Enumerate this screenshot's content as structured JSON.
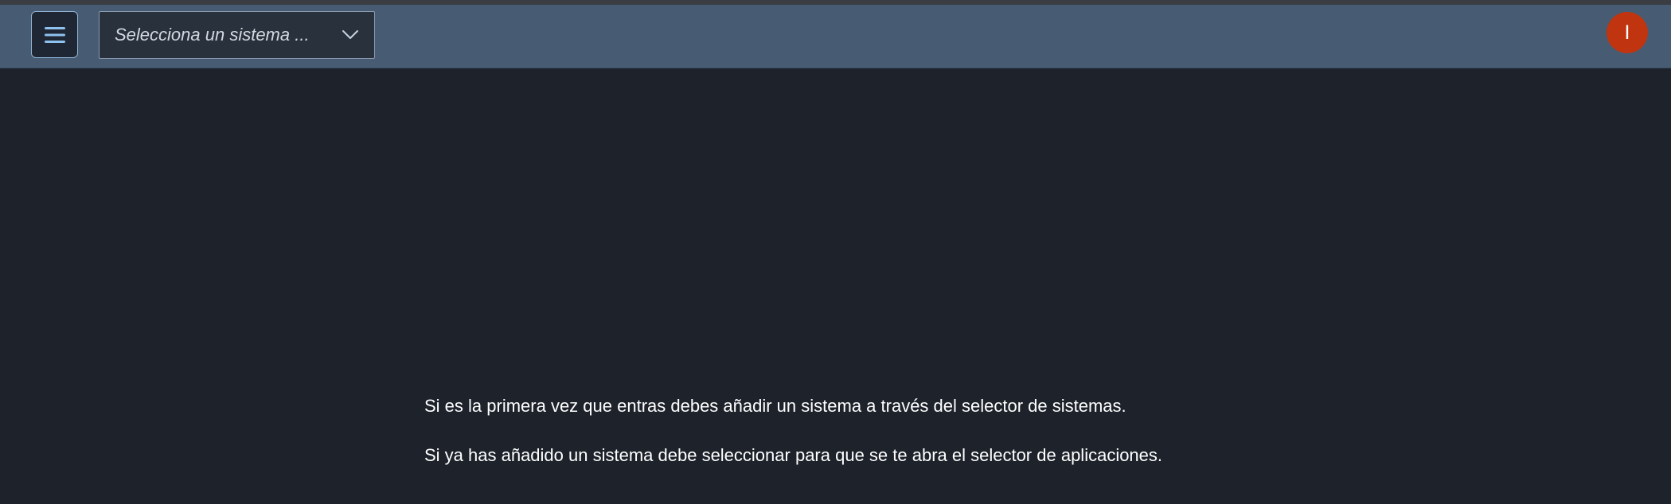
{
  "shell": {
    "menu_icon": "hamburger-icon",
    "system_selector": {
      "placeholder": "Selecciona un sistema ...",
      "icon": "chevron-down-icon"
    },
    "avatar": {
      "initial": "I",
      "color": "#c0350f"
    },
    "bar_color": "#475b73"
  },
  "main": {
    "messages": [
      "Si es la primera vez que entras debes añadir un sistema a través del selector de sistemas.",
      "Si ya has añadido un sistema debe seleccionar para que se te abra el selector de aplicaciones."
    ],
    "background_color": "#1d222b"
  }
}
